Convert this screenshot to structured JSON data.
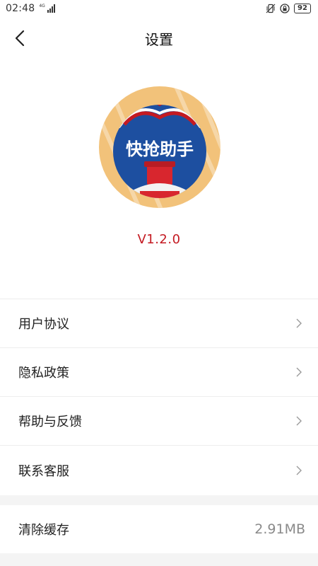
{
  "status_bar": {
    "time": "02:48",
    "network_tag": "4G",
    "battery": "92"
  },
  "header": {
    "title": "设置",
    "back_icon": "chevron-left-icon"
  },
  "app": {
    "logo_text": "快抢助手",
    "version": "V1.2.0",
    "brand_red": "#c41a22",
    "brand_blue": "#1d4fa0",
    "brand_gold": "#f2c27a"
  },
  "menu": {
    "items": [
      {
        "label": "用户协议",
        "icon": "chevron-right-icon"
      },
      {
        "label": "隐私政策",
        "icon": "chevron-right-icon"
      },
      {
        "label": "帮助与反馈",
        "icon": "chevron-right-icon"
      },
      {
        "label": "联系客服",
        "icon": "chevron-right-icon"
      }
    ]
  },
  "cache": {
    "label": "清除缓存",
    "value": "2.91MB"
  }
}
